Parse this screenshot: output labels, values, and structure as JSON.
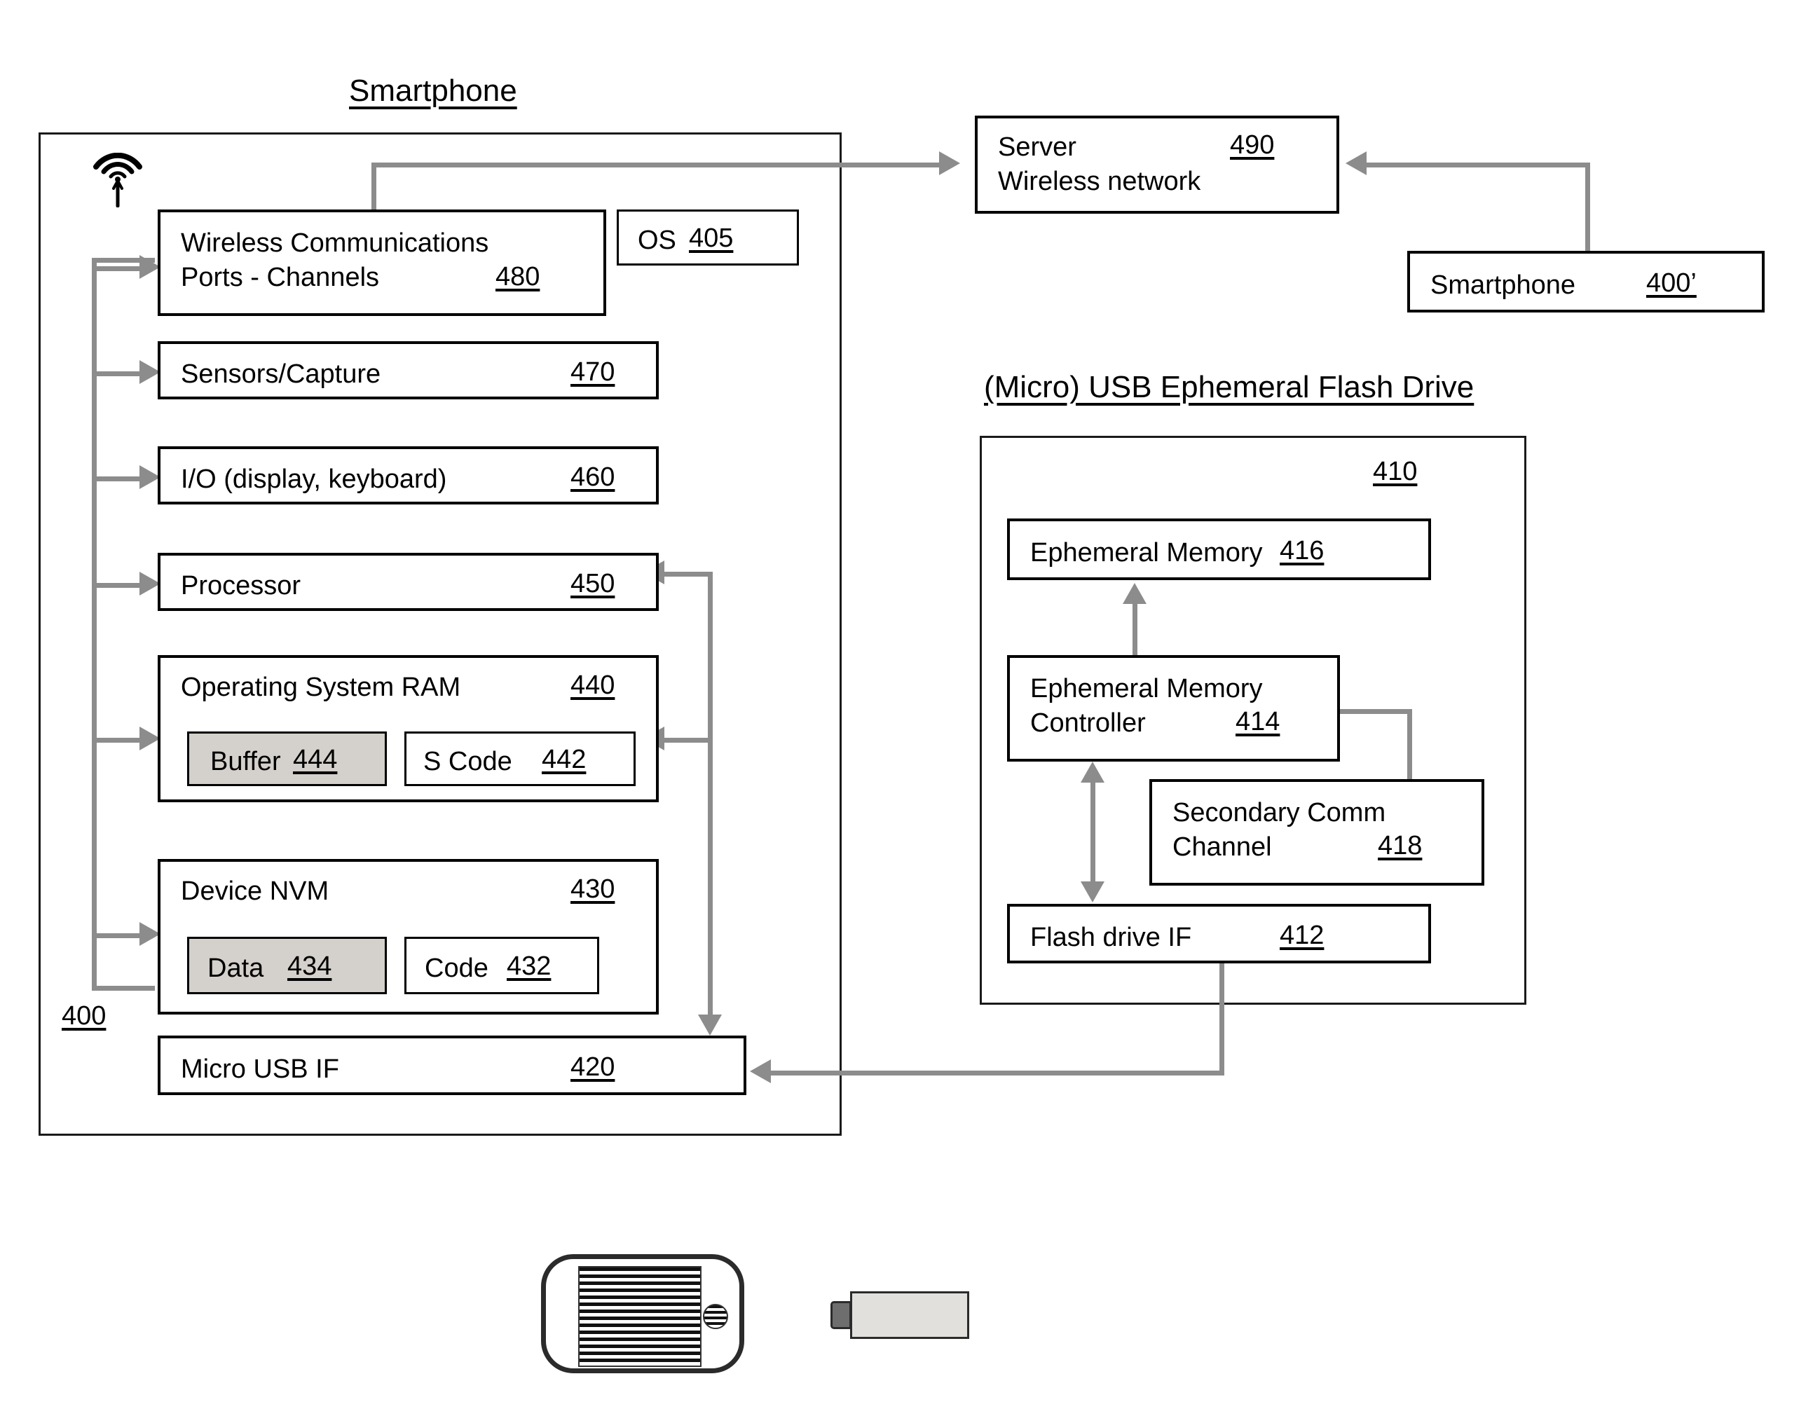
{
  "figure": {
    "smartphone_title": "Smartphone",
    "smartphone_ref": "400",
    "flash_drive_title": "(Micro) USB Ephemeral Flash Drive",
    "flash_drive_ref": "410"
  },
  "smartphone_blocks": [
    {
      "id": "wireless_comm",
      "label": "Wireless Communications\nPorts - Channels",
      "ref": "480"
    },
    {
      "id": "os",
      "label": "OS",
      "ref": "405"
    },
    {
      "id": "sensors",
      "label": "Sensors/Capture",
      "ref": "470"
    },
    {
      "id": "io",
      "label": "I/O (display, keyboard)",
      "ref": "460"
    },
    {
      "id": "processor",
      "label": "Processor",
      "ref": "450"
    },
    {
      "id": "os_ram",
      "label": "Operating System RAM",
      "ref": "440"
    },
    {
      "id": "buffer",
      "label": "Buffer",
      "ref": "444"
    },
    {
      "id": "s_code",
      "label": "S Code",
      "ref": "442"
    },
    {
      "id": "device_nvm",
      "label": "Device NVM",
      "ref": "430"
    },
    {
      "id": "data",
      "label": "Data",
      "ref": "434"
    },
    {
      "id": "code",
      "label": "Code",
      "ref": "432"
    },
    {
      "id": "micro_usb_if",
      "label": "Micro USB IF",
      "ref": "420"
    }
  ],
  "external_blocks": [
    {
      "id": "server",
      "label": "Server\nWireless network",
      "ref": "490"
    },
    {
      "id": "smartphone2",
      "label": "Smartphone",
      "ref": "400’"
    }
  ],
  "flash_drive_blocks": [
    {
      "id": "ephemeral_memory",
      "label": "Ephemeral Memory",
      "ref": "416"
    },
    {
      "id": "ephemeral_memory_controller",
      "label": "Ephemeral Memory\nController",
      "ref": "414"
    },
    {
      "id": "secondary_comm_channel",
      "label": "Secondary Comm\nChannel",
      "ref": "418"
    },
    {
      "id": "flash_drive_if",
      "label": "Flash drive IF",
      "ref": "412"
    }
  ],
  "icons": {
    "wifi": "wireless-signal-icon",
    "phone": "smartphone-illustration",
    "usb": "usb-flash-drive-illustration"
  },
  "colors": {
    "line": "#8c8c8c",
    "stroke": "#000000",
    "shaded_fill": "#d4d0cb",
    "background": "#ffffff"
  }
}
